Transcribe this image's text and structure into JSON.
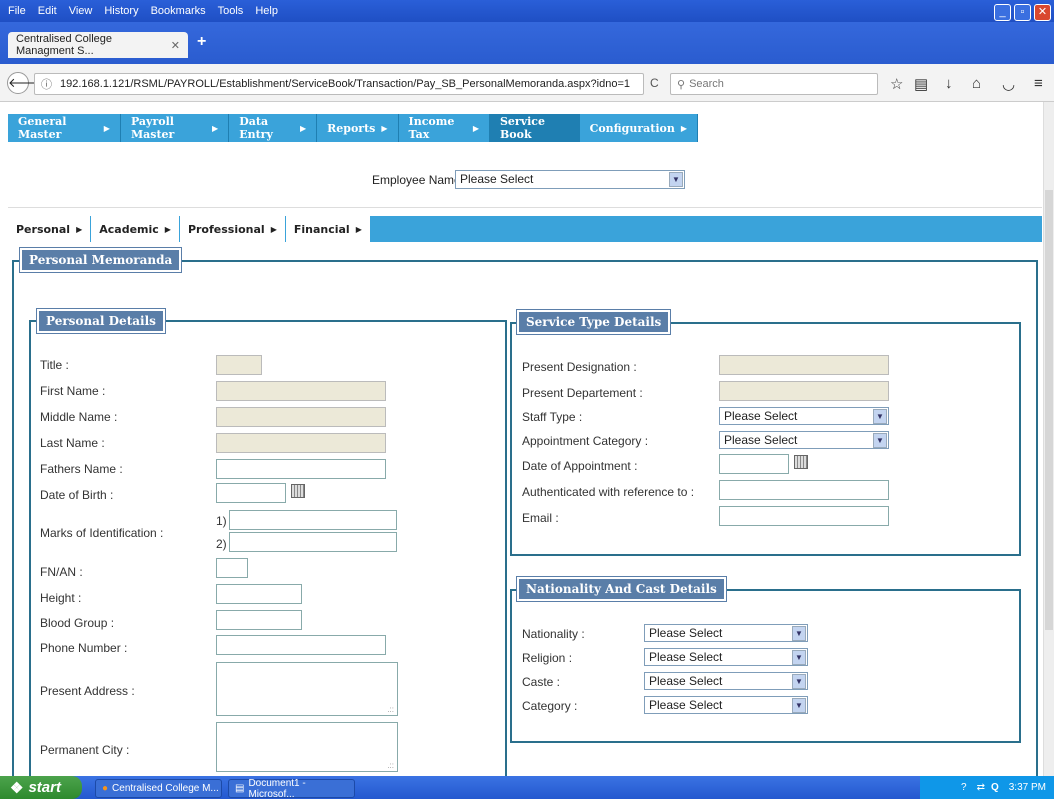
{
  "browser": {
    "menu": [
      "File",
      "Edit",
      "View",
      "History",
      "Bookmarks",
      "Tools",
      "Help"
    ],
    "tab_title": "Centralised College Managment S...",
    "url": "192.168.1.121/RSML/PAYROLL/Establishment/ServiceBook/Transaction/Pay_SB_PersonalMemoranda.aspx?idno=1",
    "search_placeholder": "Search"
  },
  "app_menu": [
    {
      "label": "General Master",
      "has_arrow": true
    },
    {
      "label": "Payroll Master",
      "has_arrow": true
    },
    {
      "label": "Data Entry",
      "has_arrow": true
    },
    {
      "label": "Reports",
      "has_arrow": true
    },
    {
      "label": "Income Tax",
      "has_arrow": true
    },
    {
      "label": "Service Book",
      "has_arrow": false,
      "active": true
    },
    {
      "label": "Configuration",
      "has_arrow": true
    }
  ],
  "employee": {
    "label": "Employee Name",
    "value": "Please Select"
  },
  "sub_menu": [
    "Personal",
    "Academic",
    "Professional",
    "Financial"
  ],
  "memoranda_legend": "Personal Memoranda",
  "personal": {
    "legend": "Personal Details",
    "title": "Title :",
    "first_name": "First Name :",
    "middle_name": "Middle Name :",
    "last_name": "Last Name :",
    "fathers_name": "Fathers Name :",
    "dob": "Date of Birth :",
    "marks": "Marks of Identification :",
    "mark1": "1)",
    "mark2": "2)",
    "fnan": "FN/AN :",
    "height": "Height :",
    "blood": "Blood Group :",
    "phone": "Phone Number :",
    "present_address": "Present Address :",
    "permanent_city": "Permanent City :"
  },
  "service": {
    "legend": "Service Type Details",
    "designation": "Present Designation :",
    "department": "Present Departement :",
    "staff_type": "Staff Type :",
    "staff_type_value": "Please Select",
    "appt_category": "Appointment Category :",
    "appt_category_value": "Please Select",
    "appt_date": "Date of Appointment :",
    "authenticated": "Authenticated with reference to :",
    "email": "Email :"
  },
  "nationality": {
    "legend": "Nationality And Cast Details",
    "nationality": "Nationality :",
    "nationality_value": "Please Select",
    "religion": "Religion :",
    "religion_value": "Please Select",
    "caste": "Caste :",
    "caste_value": "Please Select",
    "category": "Category :",
    "category_value": "Please Select"
  },
  "taskbar": {
    "start": "start",
    "task1": "Centralised College M...",
    "task2": "Document1 - Microsof...",
    "clock": "3:37 PM"
  }
}
